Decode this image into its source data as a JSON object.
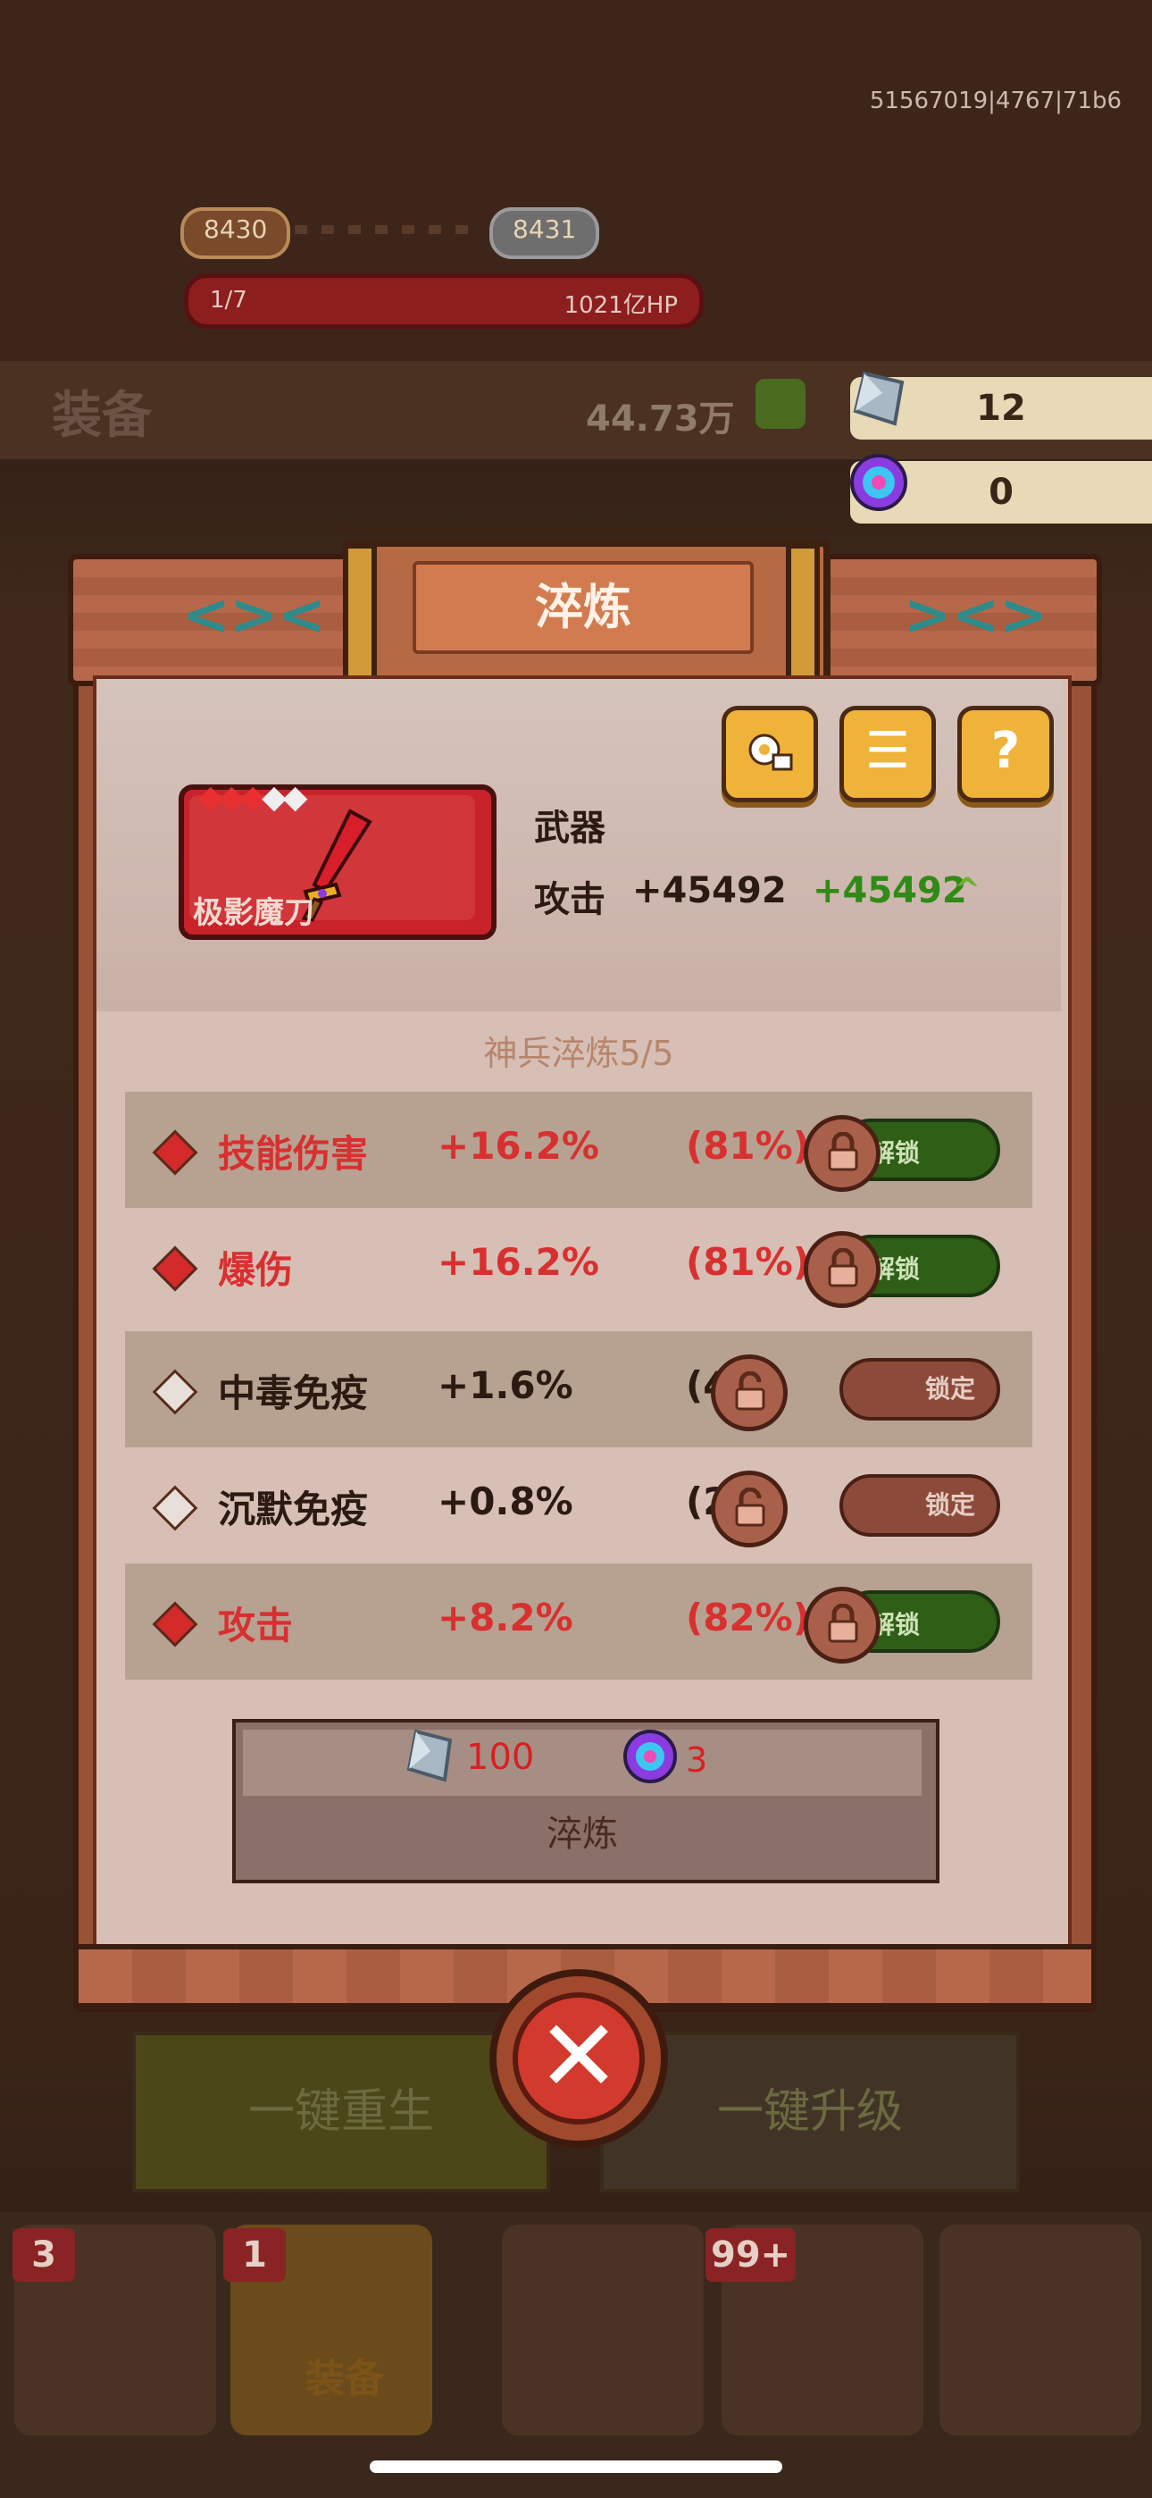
{
  "build_id": "51567019|4767|71b6",
  "stage": {
    "current": "8430",
    "next": "8431"
  },
  "boss_hp": {
    "progress": "1/7",
    "hp": "1021亿HP"
  },
  "equip_header": {
    "title": "装备",
    "power": "44.73万"
  },
  "resources": {
    "crystal": "12",
    "orb": "0"
  },
  "dialog": {
    "title": "淬炼",
    "item": {
      "name": "极影魔刀",
      "type": "武器",
      "stars_red": 3,
      "stars_white": 2
    },
    "attack": {
      "label": "攻击",
      "value": "+45492",
      "bonus": "+45492"
    },
    "section_title": "神兵淬炼5/5",
    "rows": [
      {
        "name": "技能伤害",
        "value": "+16.2%",
        "pct": "(81%)",
        "tier": "red",
        "button": "解锁",
        "locked": true
      },
      {
        "name": "爆伤",
        "value": "+16.2%",
        "pct": "(81%)",
        "tier": "red",
        "button": "解锁",
        "locked": true
      },
      {
        "name": "中毒免疫",
        "value": "+1.6%",
        "pct": "(4%)",
        "tier": "white",
        "button": "锁定",
        "locked": false
      },
      {
        "name": "沉默免疫",
        "value": "+0.8%",
        "pct": "(2%)",
        "tier": "white",
        "button": "锁定",
        "locked": false
      },
      {
        "name": "攻击",
        "value": "+8.2%",
        "pct": "(82%)",
        "tier": "red",
        "button": "解锁",
        "locked": true
      }
    ],
    "cost": {
      "crystal": "100",
      "orb": "3"
    },
    "refine_button": "淬炼",
    "close_icon": "close-icon"
  },
  "bottom_buttons": {
    "rebirth": "一键重生",
    "upgrade": "一键升级"
  },
  "nav": {
    "badges": [
      "3",
      "1",
      "99+"
    ],
    "active_label": "装备"
  },
  "colors": {
    "accent_red": "#d83030",
    "bonus_green": "#2f8a16",
    "button_gold": "#efb33a"
  }
}
